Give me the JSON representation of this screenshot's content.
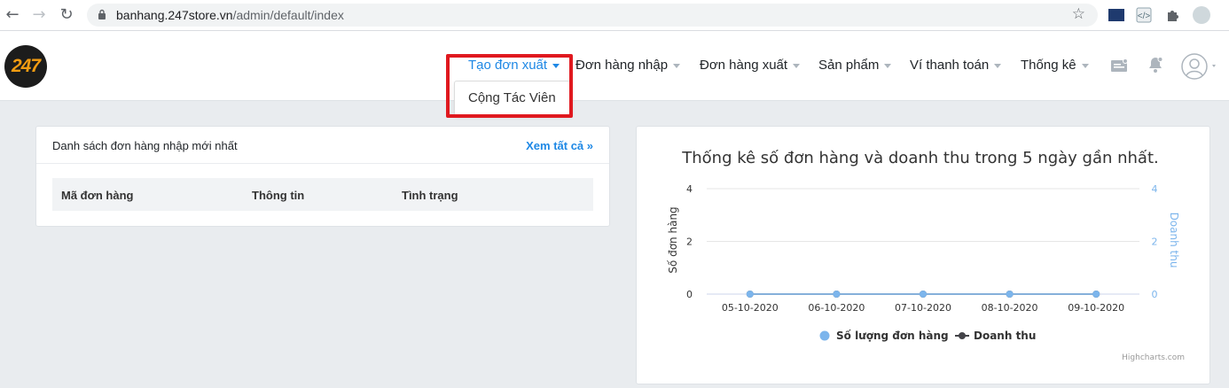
{
  "browser": {
    "url_host": "banhang.247store.vn",
    "url_path": "/admin/default/index"
  },
  "header": {
    "logo_text": "247",
    "menu": [
      {
        "label": "Tạo đơn xuất"
      },
      {
        "label": "Đơn hàng nhập"
      },
      {
        "label": "Đơn hàng xuất"
      },
      {
        "label": "Sản phẩm"
      },
      {
        "label": "Ví thanh toán"
      },
      {
        "label": "Thống kê"
      }
    ],
    "dropdown": {
      "items": [
        "Cộng Tác Viên"
      ]
    }
  },
  "orders_card": {
    "title": "Danh sách đơn hàng nhập mới nhất",
    "see_all": "Xem tất cả »",
    "columns": [
      "Mã đơn hàng",
      "Thông tin",
      "Tình trạng"
    ]
  },
  "chart_data": {
    "type": "line",
    "title": "Thống kê số đơn hàng và doanh thu trong 5 ngày gần nhất.",
    "categories": [
      "05-10-2020",
      "06-10-2020",
      "07-10-2020",
      "08-10-2020",
      "09-10-2020"
    ],
    "series": [
      {
        "name": "Số lượng đơn hàng",
        "values": [
          0,
          0,
          0,
          0,
          0
        ],
        "color": "#7cb5ec"
      },
      {
        "name": "Doanh thu",
        "values": [
          0,
          0,
          0,
          0,
          0
        ],
        "color": "#434348"
      }
    ],
    "ylabel": "Số đơn hàng",
    "ylabel_right": "Doanh thu",
    "ylim": [
      0,
      4
    ],
    "yticks": [
      "0",
      "2",
      "4"
    ],
    "yticks_right": [
      "0",
      "2",
      "4"
    ],
    "credits": "Highcharts.com",
    "legend": "bottom-center",
    "grid": true
  },
  "colors": {
    "accent": "#1e88e5",
    "highlight": "#e0191f",
    "logo_orange": "#f39c12"
  }
}
